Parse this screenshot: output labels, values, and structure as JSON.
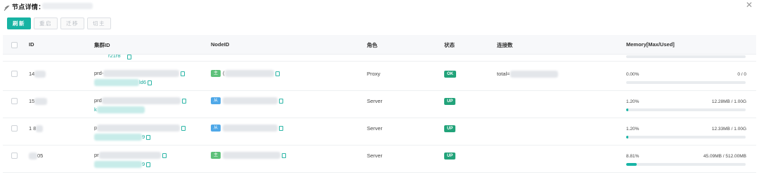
{
  "window": {
    "title": "节点详情："
  },
  "toolbar": {
    "buttons": [
      {
        "label": "刷新",
        "primary": true
      },
      {
        "label": "重启",
        "primary": false
      },
      {
        "label": "迁移",
        "primary": false
      },
      {
        "label": "切主",
        "primary": false
      }
    ]
  },
  "table": {
    "headers": {
      "id": "ID",
      "cluster_id": "集群ID",
      "node_id": "NodeID",
      "role": "角色",
      "status": "状态",
      "connections": "连接数",
      "memory": "Memory[Max/Used]"
    },
    "peek_row": {
      "cluster_link_tail": "r21r8"
    },
    "rows": [
      {
        "id_prefix": "14",
        "cluster_prefix": "prd-",
        "cluster_link_tail": "ld6",
        "node_tag": "主",
        "node_tag_color": "green",
        "node_prefix": "(",
        "role": "Proxy",
        "status": "OK",
        "connections": "total=",
        "mem_pct": "0.00%",
        "mem_val": "0 / 0",
        "mem_fraction": 0.0
      },
      {
        "id_prefix": "15",
        "cluster_prefix": "prd",
        "cluster_link_tail": "k",
        "node_tag": "从",
        "node_tag_color": "blue",
        "node_prefix": "",
        "role": "Server",
        "status": "UP",
        "connections": "",
        "mem_pct": "1.20%",
        "mem_val": "12.28MB / 1.00G",
        "mem_fraction": 0.012
      },
      {
        "id_prefix": "1 8",
        "cluster_prefix": "p",
        "cluster_link_tail": "9",
        "node_tag": "从",
        "node_tag_color": "blue",
        "node_prefix": "",
        "role": "Server",
        "status": "UP",
        "connections": "",
        "mem_pct": "1.20%",
        "mem_val": "12.33MB / 1.00G",
        "mem_fraction": 0.012
      },
      {
        "id_prefix": "05",
        "cluster_prefix": "pr",
        "cluster_link_tail": "9",
        "node_tag": "主",
        "node_tag_color": "green",
        "node_prefix": "",
        "role": "Server",
        "status": "UP",
        "connections": "",
        "mem_pct": "8.81%",
        "mem_val": "45.09MB / 512.00MB",
        "mem_fraction": 0.0881
      }
    ]
  },
  "icons": {
    "title": "feather-icon",
    "close": "close-icon",
    "copy": "copy-icon"
  },
  "colors": {
    "accent": "#17b3a3",
    "status_ok": "#22a37a",
    "tag_master": "#5ec17a",
    "tag_slave": "#4fa8e8"
  }
}
